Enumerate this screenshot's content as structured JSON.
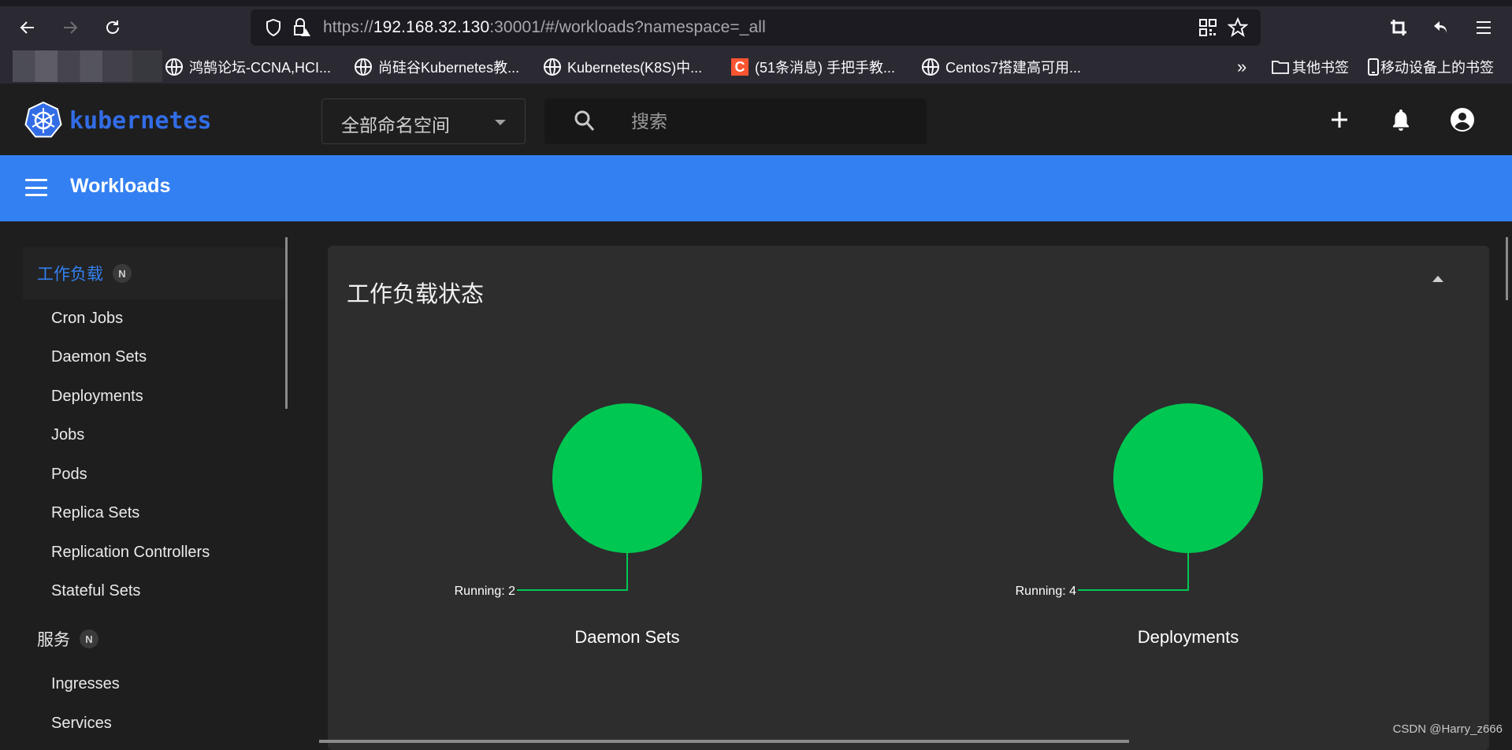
{
  "browser": {
    "url": {
      "scheme": "https://",
      "host": "192.168.32.130",
      "rest": ":30001/#/workloads?namespace=_all"
    },
    "nav": {
      "back": "back-icon",
      "forward": "forward-icon",
      "reload": "reload-icon"
    },
    "bookmarks": [
      {
        "label": "鸿鹄论坛-CCNA,HCI...",
        "icon": "globe-icon"
      },
      {
        "label": "尚硅谷Kubernetes教...",
        "icon": "globe-icon"
      },
      {
        "label": "Kubernetes(K8S)中...",
        "icon": "globe-icon"
      },
      {
        "label": "(51条消息) 手把手教...",
        "icon": "csdn-icon",
        "icon_text": "C"
      },
      {
        "label": "Centos7搭建高可用...",
        "icon": "globe-icon"
      }
    ],
    "bookmarks_overflow": "»",
    "other_bookmarks": "其他书签",
    "mobile_bookmarks": "移动设备上的书签"
  },
  "header": {
    "logo_text": "kubernetes",
    "namespace": {
      "selected": "全部命名空间"
    },
    "search": {
      "placeholder": "搜索",
      "value": ""
    },
    "actions": [
      "add-icon",
      "notifications-icon",
      "account-icon"
    ]
  },
  "titlebar": {
    "title": "Workloads"
  },
  "sidebar": {
    "groups": [
      {
        "label": "工作负载",
        "badge": "N",
        "active": true,
        "items": [
          "Cron Jobs",
          "Daemon Sets",
          "Deployments",
          "Jobs",
          "Pods",
          "Replica Sets",
          "Replication Controllers",
          "Stateful Sets"
        ]
      },
      {
        "label": "服务",
        "badge": "N",
        "active": false,
        "items": [
          "Ingresses",
          "Services"
        ]
      }
    ]
  },
  "main": {
    "card_title": "工作负载状态"
  },
  "chart_data": [
    {
      "type": "pie",
      "title": "Daemon Sets",
      "series": [
        {
          "name": "Running",
          "value": 2,
          "color": "#00c752"
        }
      ],
      "labels": [
        "Running: 2"
      ]
    },
    {
      "type": "pie",
      "title": "Deployments",
      "series": [
        {
          "name": "Running",
          "value": 4,
          "color": "#00c752"
        }
      ],
      "labels": [
        "Running: 4"
      ]
    }
  ],
  "colors": {
    "accent": "#3380f2",
    "brand": "#326de6",
    "running": "#00c752"
  },
  "watermark": "CSDN @Harry_z666"
}
